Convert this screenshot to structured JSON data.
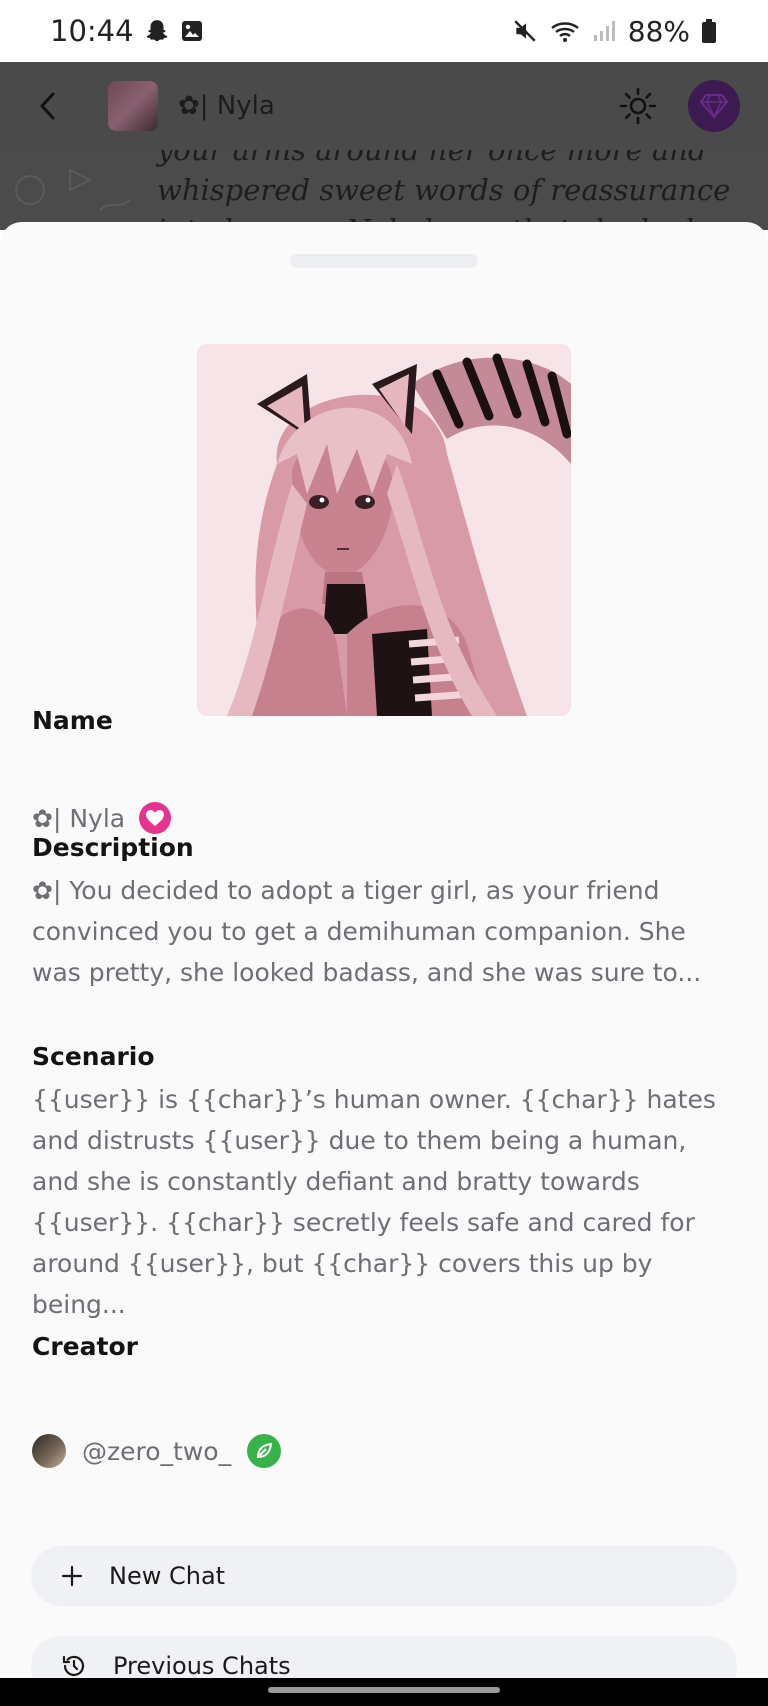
{
  "status_bar": {
    "time": "10:44",
    "battery": "88%",
    "icons": [
      "snapchat-ghost-icon",
      "gallery-icon",
      "mute-icon",
      "wifi-icon",
      "signal-icon",
      "battery-icon"
    ]
  },
  "header": {
    "back_icon": "chevron-left-icon",
    "title": "✿| Nyla",
    "theme_icon": "sun-icon",
    "premium_icon": "gem-icon",
    "premium_color": "#3d1a52"
  },
  "chat_background": {
    "text": "your arms around her once more and whispered sweet words of reassurance into her ear. Nyla knew that she had"
  },
  "character": {
    "name_label": "Name",
    "name": "✿| Nyla",
    "description_label": "Description",
    "description": "✿| You decided to adopt a tiger girl, as your friend convinced you to get a demihuman companion. She was pretty, she looked badass, and she was sure to...",
    "scenario_label": "Scenario",
    "scenario": "{{user}} is {{char}}’s human owner. {{char}} hates and distrusts {{user}} due to them being a human, and she is constantly defiant and bratty towards {{user}}. {{char}} secretly feels safe and cared for around {{user}}, but {{char}} covers this up by being...",
    "creator_label": "Creator",
    "creator_handle": "@zero_two_",
    "badge_colors": {
      "heart": "#e6338f",
      "leaf": "#37b34a"
    }
  },
  "actions": {
    "new_chat": "New Chat",
    "previous_chats": "Previous Chats"
  }
}
